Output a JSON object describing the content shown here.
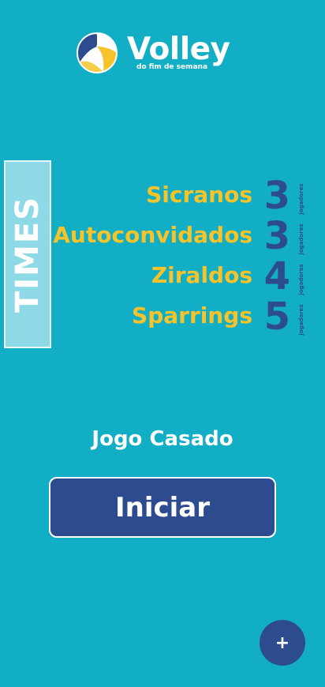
{
  "logo": {
    "title": "Volley",
    "subtitle": "do fim de semana",
    "icon": "volleyball-icon"
  },
  "side_tab": {
    "label": "TIMES"
  },
  "teams": [
    {
      "name": "Sicranos",
      "count": "3",
      "unit": "jogadores"
    },
    {
      "name": "Autoconvidados",
      "count": "3",
      "unit": "jogadores"
    },
    {
      "name": "Ziraldos",
      "count": "4",
      "unit": "jogadores"
    },
    {
      "name": "Sparrings",
      "count": "5",
      "unit": "jogadores"
    }
  ],
  "game_mode": "Jogo Casado",
  "start_button": "Iniciar",
  "fab": {
    "label": "+",
    "icon": "plus-icon"
  },
  "colors": {
    "background": "#12aec5",
    "team_name": "#f6c32b",
    "accent": "#2d4b8f",
    "tab": "#8ed9e6"
  }
}
